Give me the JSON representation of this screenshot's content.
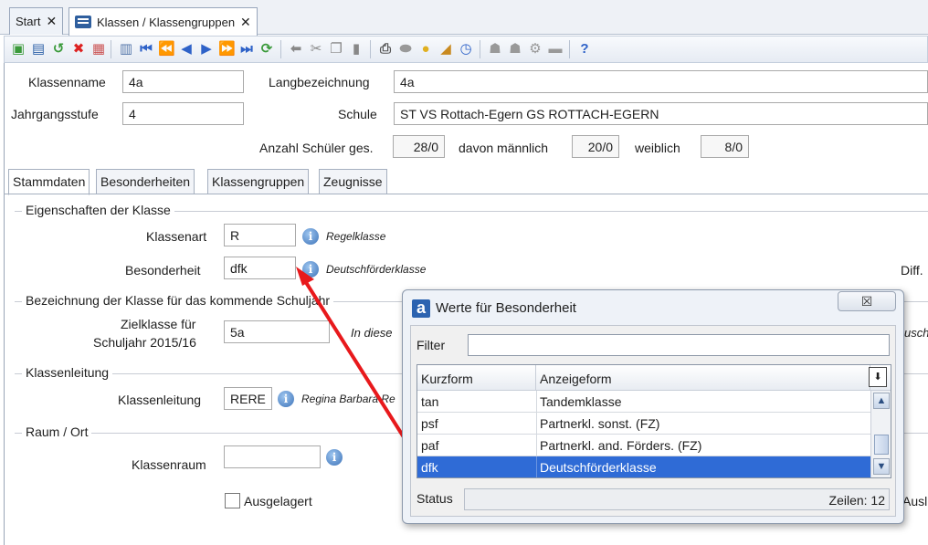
{
  "tabs": {
    "start_label": "Start",
    "start_close": "✕",
    "klassen_label": "Klassen / Klassengruppen",
    "klassen_close": "✕"
  },
  "toolbar": {
    "icons": [
      "new-icon",
      "save-icon",
      "undo-icon",
      "delete-icon",
      "edit-icon",
      "list-icon",
      "first-icon",
      "prev-page-icon",
      "prev-icon",
      "next-icon",
      "next-page-icon",
      "last-icon",
      "refresh-icon",
      "arrow-left-icon",
      "cut-icon",
      "copy-icon",
      "paste-icon",
      "print-icon",
      "preview-icon",
      "bulb-icon",
      "broom-icon",
      "clock-icon",
      "users-icon",
      "users2-icon",
      "settings-icon",
      "note-icon",
      "help-icon"
    ]
  },
  "header": {
    "klassenname_label": "Klassenname",
    "klassenname_value": "4a",
    "langbezeichnung_label": "Langbezeichnung",
    "langbezeichnung_value": "4a",
    "jahrgangsstufe_label": "Jahrgangsstufe",
    "jahrgangsstufe_value": "4",
    "schule_label": "Schule",
    "schule_value": "ST VS Rottach-Egern GS ROTTACH-EGERN",
    "anzahl_label": "Anzahl Schüler ges.",
    "anzahl_value": "28/0",
    "maennlich_label": "davon männlich",
    "maennlich_value": "20/0",
    "weiblich_label": "weiblich",
    "weiblich_value": "8/0"
  },
  "inner_tabs": [
    "Stammdaten",
    "Besonderheiten",
    "Klassengruppen",
    "Zeugnisse"
  ],
  "stammdaten": {
    "eigenschaften_title": "Eigenschaften der Klasse",
    "klassenart_label": "Klassenart",
    "klassenart_value": "R",
    "klassenart_hint": "Regelklasse",
    "besonderheit_label": "Besonderheit",
    "besonderheit_value": "dfk",
    "besonderheit_hint": "Deutschförderklasse",
    "diff_label": "Diff.",
    "kommendes_title": "Bezeichnung der Klasse für das kommende Schuljahr",
    "zielklasse_label_1": "Zielklasse für",
    "zielklasse_label_2": "Schuljahr 2015/16",
    "zielklasse_value": "5a",
    "zielklasse_hint": "In diese",
    "right_cut_hint": "usch",
    "klassenleitung_title": "Klassenleitung",
    "klassenleitung_label": "Klassenleitung",
    "klassenleitung_value": "RERE",
    "klassenleitung_hint": "Regina Barbara Re",
    "raum_title": "Raum / Ort",
    "klassenraum_label": "Klassenraum",
    "klassenraum_value": "",
    "ausgelagert_label": "Ausgelagert",
    "ausl_cut": "Ausl"
  },
  "dialog": {
    "title": "Werte für Besonderheit",
    "close_label": "☒",
    "filter_label": "Filter",
    "filter_value": "",
    "col_kurzform": "Kurzform",
    "col_anzeigeform": "Anzeigeform",
    "rows": [
      {
        "kurz": "tan",
        "anzeige": "Tandemklasse"
      },
      {
        "kurz": "psf",
        "anzeige": "Partnerkl. sonst. (FZ)"
      },
      {
        "kurz": "paf",
        "anzeige": "Partnerkl. and. Förders. (FZ)"
      },
      {
        "kurz": "dfk",
        "anzeige": "Deutschförderklasse"
      }
    ],
    "selected_row": 3,
    "status_label": "Status",
    "zeilen_label": "Zeilen: 12"
  },
  "colors": {
    "selection": "#2f6bd6",
    "annotation_arrow": "#e8191c"
  }
}
